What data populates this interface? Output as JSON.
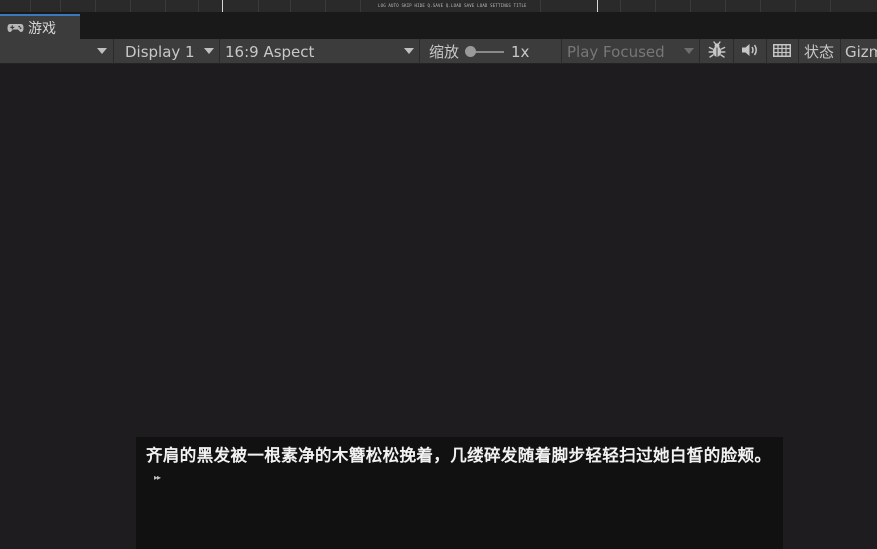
{
  "timeline": {
    "hud_text": "LOG AUTO SKIP HIDE Q.SAVE Q.LOAD SAVE LOAD SETTINGS TITLE"
  },
  "tab": {
    "label": "游戏",
    "icon": "gamepad-icon"
  },
  "toolbar": {
    "first_dropdown_value": "",
    "display": "Display 1",
    "aspect": "16:9 Aspect",
    "scale_label": "缩放",
    "scale_value": "1x",
    "play_mode": "Play Focused",
    "stats_label": "状态",
    "gizmos_label": "Gizm"
  },
  "icons": {
    "bug": "bug-icon",
    "audio": "speaker-icon",
    "grid": "keyboard-grid-icon"
  },
  "dialog": {
    "text": "齐肩的黑发被一根素净的木簪松松挽着，几缕碎发随着脚步轻轻扫过她白皙的脸颊。",
    "continue_glyph": "▸▸"
  },
  "colors": {
    "tab_accent": "#3a79bb",
    "toolbar_bg": "#3c3c3c",
    "game_bg": "#1f1c1f",
    "dialog_bg": "#121111"
  }
}
